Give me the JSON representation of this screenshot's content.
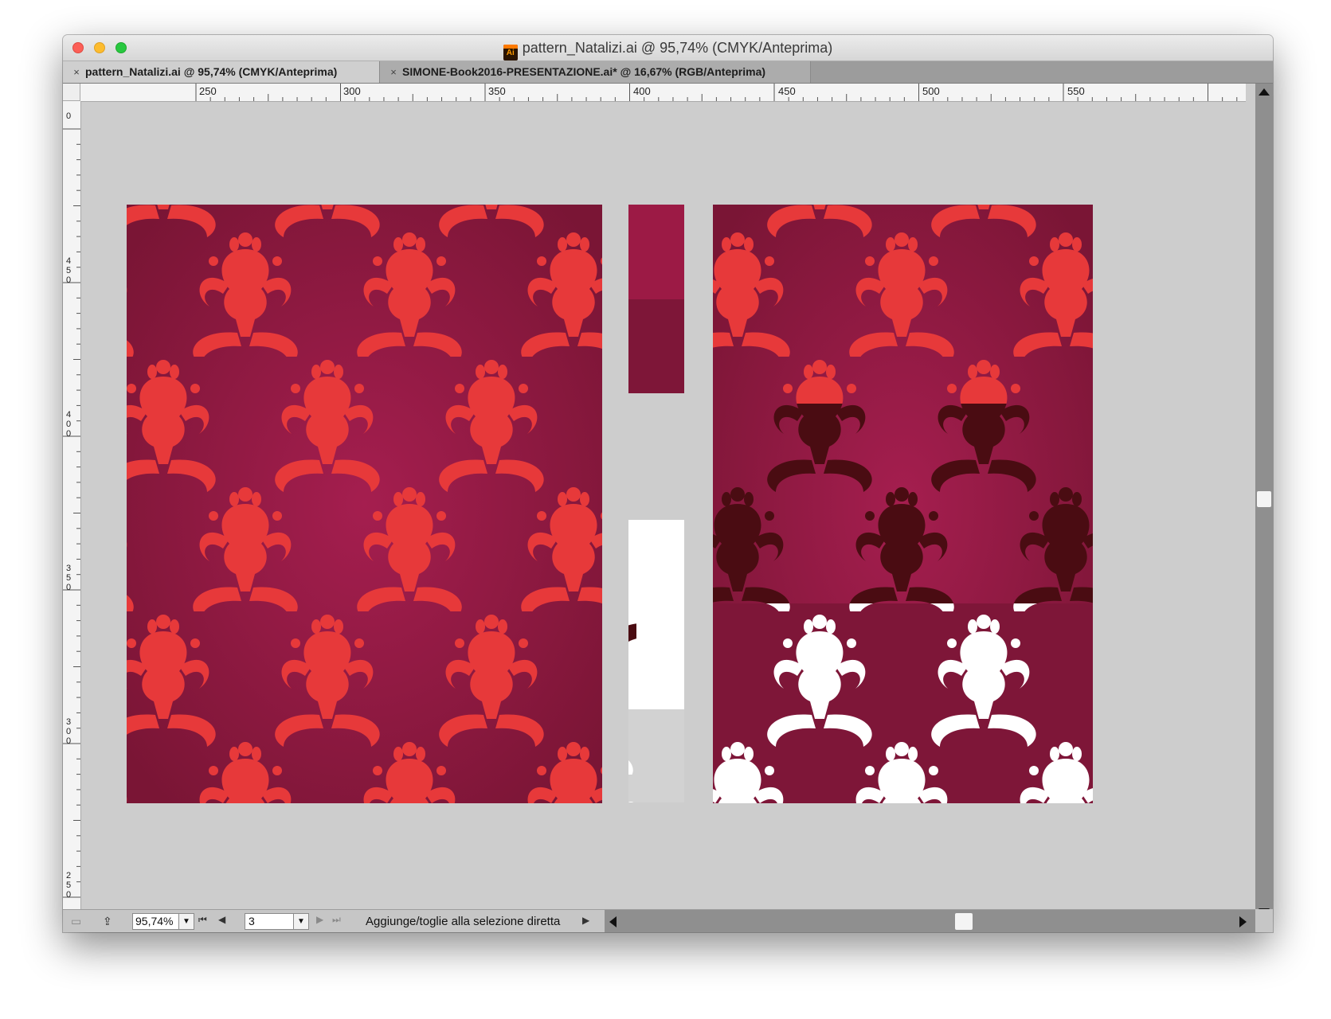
{
  "window": {
    "title": "pattern_Natalizi.ai @ 95,74% (CMYK/Anteprima)"
  },
  "tabs": [
    {
      "label": "pattern_Natalizi.ai @ 95,74% (CMYK/Anteprima)",
      "close": "×",
      "active": true
    },
    {
      "label": "SIMONE-Book2016-PRESENTAZIONE.ai* @ 16,67% (RGB/Anteprima)",
      "close": "×",
      "active": false
    }
  ],
  "rulers": {
    "horizontal_labels": [
      "250",
      "300",
      "350",
      "400",
      "450",
      "500",
      "550"
    ],
    "vertical_labels": [
      "0",
      "450",
      "400",
      "350",
      "300",
      "250"
    ]
  },
  "artboard": {
    "swatches": [
      {
        "name": "light crimson",
        "color": "#9c1a45"
      },
      {
        "name": "dark crimson",
        "color": "#7e1638"
      }
    ],
    "pattern_colors": {
      "background": "#8a1a3d",
      "background_center": "#a51e4f",
      "red_ornament": "#e7393a",
      "dark_ornament": "#4a0c12",
      "white_ornament": "#ffffff"
    }
  },
  "statusbar": {
    "zoom": "95,74%",
    "page": "3",
    "status_text": "Aggiunge/toglie alla selezione diretta",
    "dropdown_arrow": "▼",
    "nav_first": "⏮",
    "nav_prev": "◀",
    "nav_next": "▶",
    "nav_last": "⏭",
    "play": "▶"
  }
}
